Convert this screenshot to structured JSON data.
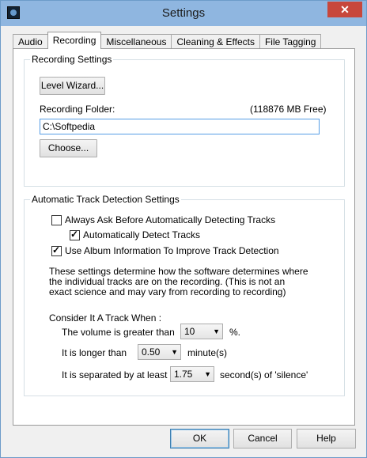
{
  "window": {
    "title": "Settings",
    "close_symbol": "✕"
  },
  "tabs": [
    {
      "label": "Audio"
    },
    {
      "label": "Recording"
    },
    {
      "label": "Miscellaneous"
    },
    {
      "label": "Cleaning & Effects"
    },
    {
      "label": "File Tagging"
    }
  ],
  "recording_settings": {
    "title": "Recording Settings",
    "level_wizard_label": "Level Wizard...",
    "folder_label": "Recording Folder:",
    "free_space": "(118876 MB Free)",
    "folder_value": "C:\\Softpedia",
    "choose_label": "Choose..."
  },
  "detection": {
    "title": "Automatic Track Detection Settings",
    "always_ask": {
      "label": "Always Ask Before Automatically Detecting Tracks",
      "checked": false
    },
    "auto_detect": {
      "label": "Automatically Detect Tracks",
      "checked": true
    },
    "use_album": {
      "label": "Use Album Information To Improve Track Detection",
      "checked": true
    },
    "description": "These settings determine how the software determines where the individual tracks are on the recording.  (This is not an exact science and may vary from recording to recording)",
    "consider_label": "Consider It A Track When :",
    "volume_label": "The volume is greater than",
    "volume_value": "10",
    "volume_unit": "%.",
    "longer_label": "It is longer than",
    "longer_value": "0.50",
    "longer_unit": "minute(s)",
    "separated_label": "It is separated by at least",
    "separated_value": "1.75",
    "separated_unit": "second(s) of 'silence'"
  },
  "footer": {
    "ok": "OK",
    "cancel": "Cancel",
    "help": "Help"
  }
}
